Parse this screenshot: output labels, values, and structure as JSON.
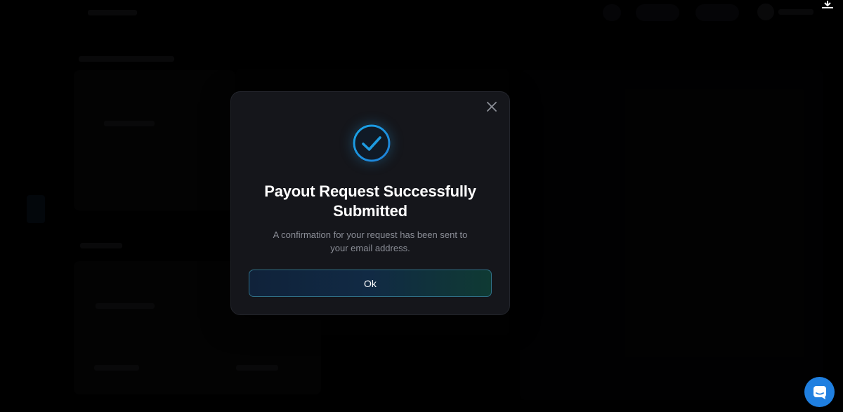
{
  "modal": {
    "title_line1": "Payout Request Successfully",
    "title_line2": "Submitted",
    "desc_line1": "A confirmation for your request has been sent to",
    "desc_line2": "your email address.",
    "ok_label": "Ok",
    "close_icon": "close-icon",
    "success_icon": "check-circle-icon"
  },
  "colors": {
    "accent": "#1e9be0",
    "chat_launcher": "#1f7fe0",
    "modal_bg": "#15161b"
  }
}
